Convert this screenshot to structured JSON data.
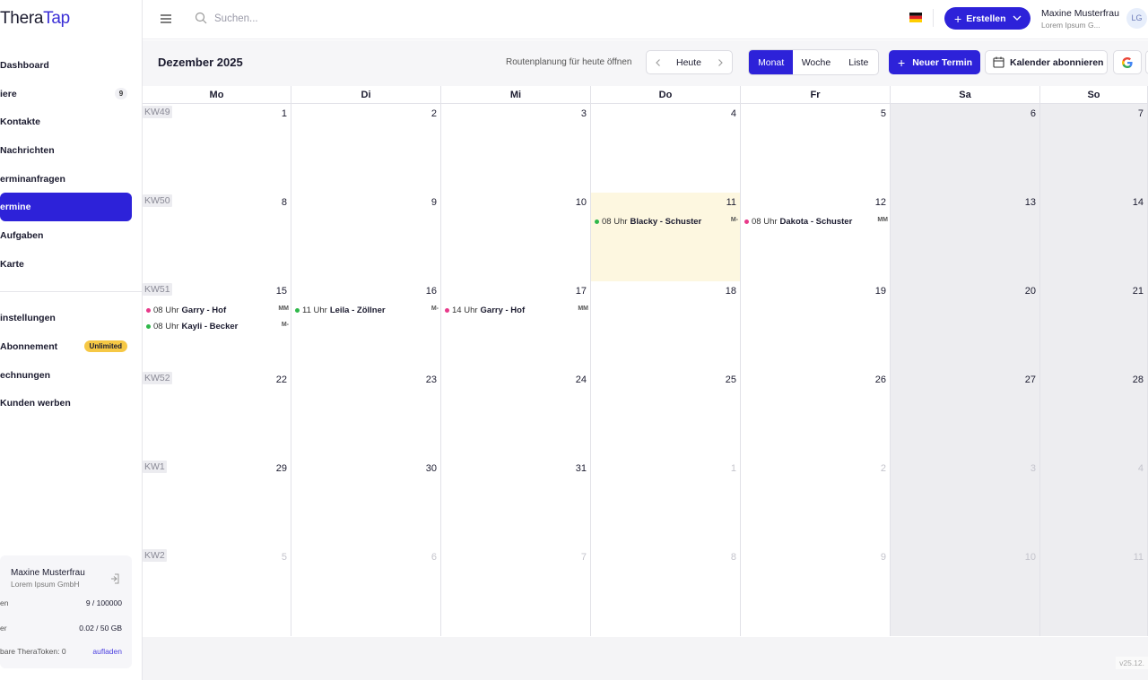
{
  "app": {
    "logo_part1": "Thera",
    "logo_part2": "Tap",
    "brand_color": "#2d22d9"
  },
  "sidebar": {
    "items": [
      {
        "label": "Dashboard",
        "name": "sidebar-item-dashboard",
        "badge": ""
      },
      {
        "label": "iere",
        "name": "sidebar-item-tiere",
        "badge": "9"
      },
      {
        "label": "Kontakte",
        "name": "sidebar-item-kontakte",
        "badge": ""
      },
      {
        "label": "Nachrichten",
        "name": "sidebar-item-nachrichten",
        "badge": ""
      },
      {
        "label": "erminanfragen",
        "name": "sidebar-item-terminanfragen",
        "badge": ""
      },
      {
        "label": "ermine",
        "name": "sidebar-item-termine",
        "badge": "",
        "active": true
      },
      {
        "label": "Aufgaben",
        "name": "sidebar-item-aufgaben",
        "badge": ""
      },
      {
        "label": "Karte",
        "name": "sidebar-item-karte",
        "badge": ""
      }
    ],
    "items2": [
      {
        "label": "instellungen",
        "name": "sidebar-item-einstellungen",
        "badge": ""
      },
      {
        "label": "Abonnement",
        "name": "sidebar-item-abonnement",
        "badge": "Unlimited"
      },
      {
        "label": "echnungen",
        "name": "sidebar-item-rechnungen",
        "badge": ""
      },
      {
        "label": "Kunden werben",
        "name": "sidebar-item-kunden-werben",
        "badge": ""
      }
    ],
    "account": {
      "name": "Maxine Musterfrau",
      "company": "Lorem Ipsum GmbH",
      "row1_label": "en",
      "row1_value": "9 / 100000",
      "row2_label": "er",
      "row2_value": "0.02 / 50 GB",
      "row3_label": "bare TheraToken: 0",
      "row3_link": "aufladen"
    }
  },
  "topbar": {
    "search_placeholder": "Suchen...",
    "create_label": "Erstellen",
    "user_name": "Maxine Musterfrau",
    "user_company": "Lorem Ipsum G...",
    "avatar_initials": "LG"
  },
  "calendar": {
    "month_title": "Dezember 2025",
    "route_link": "Routenplanung für heute öffnen",
    "today_label": "Heute",
    "views": [
      "Monat",
      "Woche",
      "Liste"
    ],
    "active_view": "Monat",
    "new_appointment_label": "Neuer Termin",
    "subscribe_label": "Kalender abonnieren",
    "google_label": "G",
    "weekdays": [
      "Mo",
      "Di",
      "Mi",
      "Do",
      "Fr",
      "Sa",
      "So"
    ],
    "event_colors": {
      "green": "#2fb84a",
      "pink": "#e83a8a"
    },
    "weeks": [
      {
        "kw": "KW49",
        "days": [
          {
            "n": "1"
          },
          {
            "n": "2"
          },
          {
            "n": "3"
          },
          {
            "n": "4"
          },
          {
            "n": "5"
          },
          {
            "n": "6"
          },
          {
            "n": "7"
          }
        ]
      },
      {
        "kw": "KW50",
        "days": [
          {
            "n": "8"
          },
          {
            "n": "9"
          },
          {
            "n": "10"
          },
          {
            "n": "11",
            "today": true,
            "events": [
              {
                "time": "08 Uhr",
                "title": "Blacky - Schuster",
                "tag": "M-",
                "color": "green"
              }
            ]
          },
          {
            "n": "12",
            "events": [
              {
                "time": "08 Uhr",
                "title": "Dakota - Schuster",
                "tag": "MM",
                "color": "pink"
              }
            ]
          },
          {
            "n": "13"
          },
          {
            "n": "14"
          }
        ]
      },
      {
        "kw": "KW51",
        "days": [
          {
            "n": "15",
            "events": [
              {
                "time": "08 Uhr",
                "title": "Garry - Hof",
                "tag": "MM",
                "color": "pink"
              },
              {
                "time": "08 Uhr",
                "title": "Kayli - Becker",
                "tag": "M-",
                "color": "green"
              }
            ]
          },
          {
            "n": "16",
            "events": [
              {
                "time": "11 Uhr",
                "title": "Leila - Zöllner",
                "tag": "M-",
                "color": "green"
              }
            ]
          },
          {
            "n": "17",
            "events": [
              {
                "time": "14 Uhr",
                "title": "Garry - Hof",
                "tag": "MM",
                "color": "pink"
              }
            ]
          },
          {
            "n": "18"
          },
          {
            "n": "19"
          },
          {
            "n": "20"
          },
          {
            "n": "21"
          }
        ]
      },
      {
        "kw": "KW52",
        "days": [
          {
            "n": "22"
          },
          {
            "n": "23"
          },
          {
            "n": "24"
          },
          {
            "n": "25"
          },
          {
            "n": "26"
          },
          {
            "n": "27"
          },
          {
            "n": "28"
          }
        ]
      },
      {
        "kw": "KW1",
        "days": [
          {
            "n": "29"
          },
          {
            "n": "30"
          },
          {
            "n": "31"
          },
          {
            "n": "1",
            "other": true
          },
          {
            "n": "2",
            "other": true
          },
          {
            "n": "3",
            "other": true
          },
          {
            "n": "4",
            "other": true
          }
        ]
      },
      {
        "kw": "KW2",
        "days": [
          {
            "n": "5",
            "other": true
          },
          {
            "n": "6",
            "other": true
          },
          {
            "n": "7",
            "other": true
          },
          {
            "n": "8",
            "other": true
          },
          {
            "n": "9",
            "other": true
          },
          {
            "n": "10",
            "other": true
          },
          {
            "n": "11",
            "other": true
          }
        ]
      }
    ]
  },
  "footer": {
    "version": "v25.12."
  }
}
